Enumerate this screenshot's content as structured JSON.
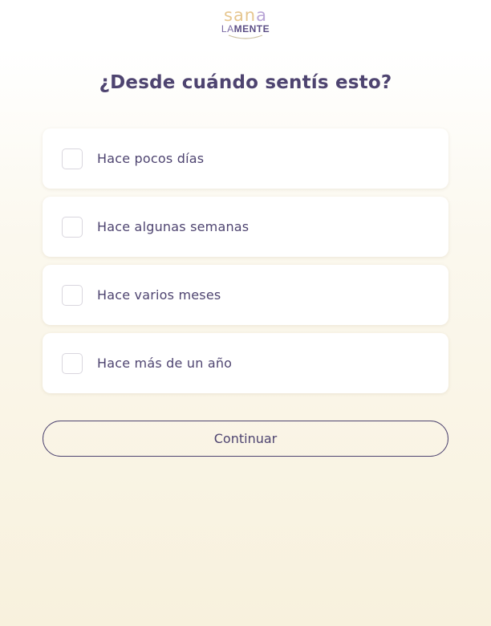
{
  "logo": {
    "top_text_a": "san",
    "top_text_b": "a",
    "bottom_text_a": "LA",
    "bottom_text_b": "MENTE"
  },
  "question": {
    "title": "¿Desde cuándo sentís esto?"
  },
  "options": [
    {
      "label": "Hace pocos días",
      "checked": false
    },
    {
      "label": "Hace algunas semanas",
      "checked": false
    },
    {
      "label": "Hace varios meses",
      "checked": false
    },
    {
      "label": "Hace más de un año",
      "checked": false
    }
  ],
  "actions": {
    "continue_label": "Continuar"
  },
  "colors": {
    "primary_text": "#4e4470",
    "logo_gold": "#e6c68f",
    "logo_lilac": "#b9a5d6",
    "background_bottom": "#f8f1dd",
    "checkbox_border": "#d9d6de"
  }
}
